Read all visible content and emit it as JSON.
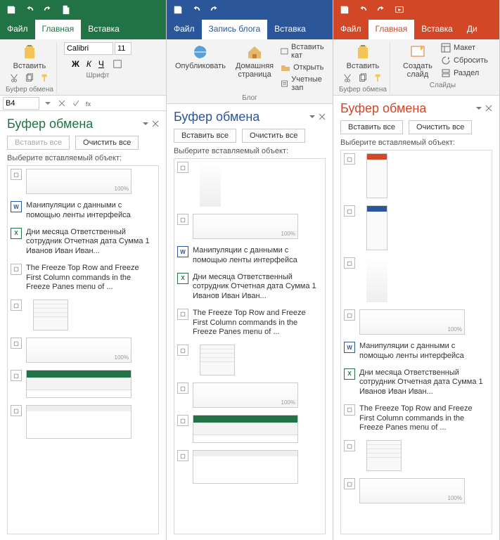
{
  "excel": {
    "tabs": {
      "file": "Файл",
      "home": "Главная",
      "insert": "Вставка"
    },
    "paste": "Вставить",
    "group_clipboard": "Буфер обмена",
    "group_font": "Шрифт",
    "font_name": "Calibri",
    "font_size": "11",
    "bold": "Ж",
    "italic": "К",
    "underline": "Ч",
    "cell_ref": "B4",
    "pane_title": "Буфер обмена",
    "paste_all": "Вставить все",
    "clear_all": "Очистить все",
    "hint": "Выберите вставляемый объект:",
    "items": {
      "t1": "Манипуляции с данными с помощью ленты интерфейса",
      "t2": "Дни месяца Ответственный сотрудник Отчетная дата Сумма 1 Иванов Иван Иван...",
      "t3": "The Freeze Top Row and Freeze First Column commands in the Freeze Panes menu of ..."
    }
  },
  "word": {
    "tabs": {
      "file": "Файл",
      "blog": "Запись блога",
      "insert": "Вставка"
    },
    "publish": "Опубликовать",
    "homepage": "Домашняя страница",
    "group_blog": "Блог",
    "link_insert_cat": "Вставить кат",
    "link_open": "Открыть",
    "link_accounts": "Учетные зап",
    "pane_title": "Буфер обмена",
    "paste_all": "Вставить все",
    "clear_all": "Очистить все",
    "hint": "Выберите вставляемый объект:",
    "items": {
      "t1": "Манипуляции с данными с помощью ленты интерфейса",
      "t2": "Дни месяца Ответственный сотрудник Отчетная дата Сумма 1 Иванов Иван Иван...",
      "t3": "The Freeze Top Row and Freeze First Column commands in the Freeze Panes menu of ..."
    }
  },
  "ppt": {
    "tabs": {
      "file": "Файл",
      "home": "Главная",
      "insert": "Вставка",
      "design": "Ди"
    },
    "paste": "Вставить",
    "newslide": "Создать слайд",
    "group_clipboard": "Буфер обмена",
    "group_slides": "Слайды",
    "link_layout": "Макет",
    "link_reset": "Сбросить",
    "link_section": "Раздел",
    "pane_title": "Буфер обмена",
    "paste_all": "Вставить все",
    "clear_all": "Очистить все",
    "hint": "Выберите вставляемый объект:",
    "items": {
      "t1": "Манипуляции с данными с помощью ленты интерфейса",
      "t2": "Дни месяца Ответственный сотрудник Отчетная дата Сумма 1 Иванов Иван Иван...",
      "t3": "The Freeze Top Row and Freeze First Column commands in the Freeze Panes menu of ..."
    }
  }
}
